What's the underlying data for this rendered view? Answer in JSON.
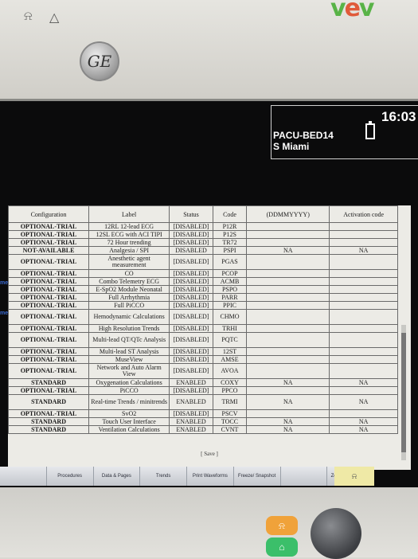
{
  "header": {
    "alarm_icon": "alarm-bell-crossed-icon",
    "warning_icon": "warning-triangle-icon",
    "brand": "GE"
  },
  "status": {
    "time": "16:03",
    "bed": "PACU-BED14",
    "unit": "S Miami",
    "battery_icon": "battery-icon"
  },
  "side_labels": [
    "ment",
    "me"
  ],
  "table": {
    "headers": {
      "configuration": "Configuration",
      "label": "Label",
      "status": "Status",
      "code": "Code",
      "expiration": "(DDMMYYYY)",
      "activation": "Activation code"
    },
    "rows": [
      {
        "configuration": "OPTIONAL-TRIAL",
        "label": "12RL 12-lead ECG",
        "status": "[DISABLED]",
        "code": "P12R",
        "expiration": "",
        "activation": ""
      },
      {
        "configuration": "OPTIONAL-TRIAL",
        "label": "12SL ECG with ACI TIPI",
        "status": "[DISABLED]",
        "code": "P12S",
        "expiration": "",
        "activation": ""
      },
      {
        "configuration": "OPTIONAL-TRIAL",
        "label": "72 Hour trending",
        "status": "[DISABLED]",
        "code": "TR72",
        "expiration": "",
        "activation": ""
      },
      {
        "configuration": "NOT-AVAILABLE",
        "label": "Analgesia / SPI",
        "status": "DISABLED",
        "code": "PSPI",
        "expiration": "NA",
        "activation": "NA"
      },
      {
        "configuration": "OPTIONAL-TRIAL",
        "label": "Anesthetic agent measurement",
        "status": "[DISABLED]",
        "code": "PGAS",
        "expiration": "",
        "activation": "",
        "tall": true
      },
      {
        "configuration": "OPTIONAL-TRIAL",
        "label": "CO",
        "status": "[DISABLED]",
        "code": "PCOP",
        "expiration": "",
        "activation": ""
      },
      {
        "configuration": "OPTIONAL-TRIAL",
        "label": "Combo Telemetry ECG",
        "status": "[DISABLED]",
        "code": "ACMB",
        "expiration": "",
        "activation": ""
      },
      {
        "configuration": "OPTIONAL-TRIAL",
        "label": "E-SpO2 Module Neonatal",
        "status": "[DISABLED]",
        "code": "PSPO",
        "expiration": "",
        "activation": ""
      },
      {
        "configuration": "OPTIONAL-TRIAL",
        "label": "Full Arrhythmia",
        "status": "[DISABLED]",
        "code": "PARR",
        "expiration": "",
        "activation": ""
      },
      {
        "configuration": "OPTIONAL-TRIAL",
        "label": "Full PiCCO",
        "status": "[DISABLED]",
        "code": "PPIC",
        "expiration": "",
        "activation": ""
      },
      {
        "configuration": "OPTIONAL-TRIAL",
        "label": "Hemodynamic Calculations",
        "status": "[DISABLED]",
        "code": "CHMO",
        "expiration": "",
        "activation": "",
        "tall": true
      },
      {
        "configuration": "OPTIONAL-TRIAL",
        "label": "High Resolution Trends",
        "status": "[DISABLED]",
        "code": "TRHI",
        "expiration": "",
        "activation": ""
      },
      {
        "configuration": "OPTIONAL-TRIAL",
        "label": "Multi-lead QT/QTc Analysis",
        "status": "[DISABLED]",
        "code": "PQTC",
        "expiration": "",
        "activation": "",
        "tall": true
      },
      {
        "configuration": "OPTIONAL-TRIAL",
        "label": "Multi-lead ST Analysis",
        "status": "[DISABLED]",
        "code": "12ST",
        "expiration": "",
        "activation": ""
      },
      {
        "configuration": "OPTIONAL-TRIAL",
        "label": "MuseView",
        "status": "[DISABLED]",
        "code": "AMSE",
        "expiration": "",
        "activation": ""
      },
      {
        "configuration": "OPTIONAL-TRIAL",
        "label": "Network and Auto Alarm View",
        "status": "[DISABLED]",
        "code": "AVOA",
        "expiration": "",
        "activation": "",
        "tall": true
      },
      {
        "configuration": "STANDARD",
        "label": "Oxygenation Calculations",
        "status": "ENABLED",
        "code": "COXY",
        "expiration": "NA",
        "activation": "NA"
      },
      {
        "configuration": "OPTIONAL-TRIAL",
        "label": "PiCCO",
        "status": "[DISABLED]",
        "code": "PPCO",
        "expiration": "",
        "activation": ""
      },
      {
        "configuration": "STANDARD",
        "label": "Real-time Trends / minitrends",
        "status": "ENABLED",
        "code": "TRMI",
        "expiration": "NA",
        "activation": "NA",
        "tall": true
      },
      {
        "configuration": "OPTIONAL-TRIAL",
        "label": "SvO2",
        "status": "[DISABLED]",
        "code": "PSCV",
        "expiration": "",
        "activation": ""
      },
      {
        "configuration": "STANDARD",
        "label": "Touch User Interface",
        "status": "ENABLED",
        "code": "TOCC",
        "expiration": "NA",
        "activation": "NA"
      },
      {
        "configuration": "STANDARD",
        "label": "Ventilation Calculations",
        "status": "ENABLED",
        "code": "CVNT",
        "expiration": "NA",
        "activation": "NA"
      }
    ],
    "save_label": "[ Save ]"
  },
  "menu": [
    {
      "label": ""
    },
    {
      "label": "Procedures"
    },
    {
      "label": "Data & Pages"
    },
    {
      "label": "Trends"
    },
    {
      "label": "Print Waveforms"
    },
    {
      "label": "Freeze/ Snapshot"
    },
    {
      "label": ""
    },
    {
      "label": "Zero All Pressures"
    }
  ],
  "colors": {
    "screen_bg": "#0b0b0c",
    "panel_bg": "#ecebe6",
    "menu_bg": "#d4d6da",
    "silence_button": "#efe9a6",
    "led_orange": "#f0a23a",
    "led_green": "#3bbf6a"
  }
}
